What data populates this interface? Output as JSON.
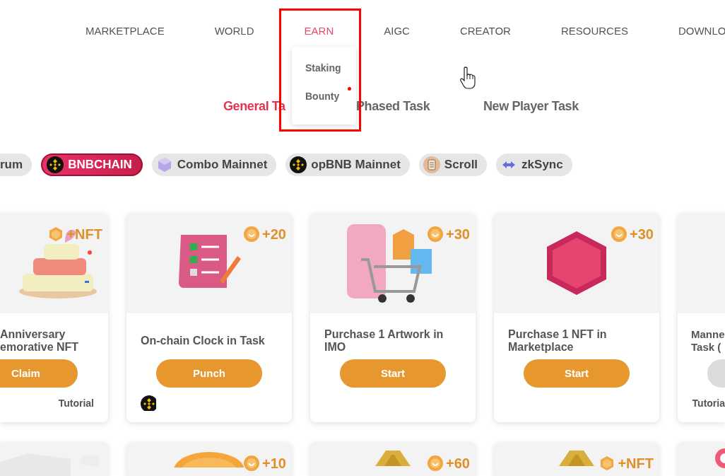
{
  "nav": [
    {
      "label": "MARKETPLACE",
      "selected": false
    },
    {
      "label": "WORLD",
      "selected": false
    },
    {
      "label": "EARN",
      "selected": true
    },
    {
      "label": "AIGC",
      "selected": false
    },
    {
      "label": "CREATOR",
      "selected": false
    },
    {
      "label": "RESOURCES",
      "selected": false
    },
    {
      "label": "DOWNLO",
      "selected": false
    }
  ],
  "earn_menu": {
    "items": [
      {
        "label": "Staking",
        "dot": false
      },
      {
        "label": "Bounty",
        "dot": true
      }
    ]
  },
  "task_tabs": [
    {
      "label": "General Ta",
      "selected": true
    },
    {
      "label": "Phased Task",
      "selected": false
    },
    {
      "label": "New Player Task",
      "selected": false
    }
  ],
  "chains": [
    {
      "label": "rum",
      "selected": false
    },
    {
      "label": "BNBCHAIN",
      "selected": true,
      "kind": "bnb"
    },
    {
      "label": "Combo Mainnet",
      "selected": false,
      "kind": "combo"
    },
    {
      "label": "opBNB Mainnet",
      "selected": false,
      "kind": "bnb"
    },
    {
      "label": "Scroll",
      "selected": false,
      "kind": "scroll"
    },
    {
      "label": "zkSync",
      "selected": false,
      "kind": "zksync"
    }
  ],
  "tasks": [
    {
      "kind": "cake",
      "reward": {
        "kind": "nft",
        "text": "+NFT"
      },
      "title": [
        "Anniversary",
        "emorative NFT"
      ],
      "button": {
        "label": "Claim",
        "disabled": false
      },
      "tutorial": "Tutorial"
    },
    {
      "kind": "checklist",
      "reward": {
        "kind": "coin",
        "text": "+20"
      },
      "title": [
        "On-chain Clock in Task"
      ],
      "button": {
        "label": "Punch",
        "disabled": false
      },
      "chain_badge": true
    },
    {
      "kind": "cart",
      "reward": {
        "kind": "coin",
        "text": "+30"
      },
      "title": [
        "Purchase 1 Artwork in",
        "IMO"
      ],
      "button": {
        "label": "Start",
        "disabled": false
      }
    },
    {
      "kind": "hexagon",
      "reward": {
        "kind": "coin",
        "text": "+30"
      },
      "title": [
        "Purchase 1 NFT in",
        "Marketplace"
      ],
      "button": {
        "label": "Start",
        "disabled": false
      }
    },
    {
      "title": [
        "Manne",
        "Task ("
      ],
      "button": {
        "disabled": true
      },
      "tutorial": "Tutoria"
    }
  ],
  "more_tasks": [
    {
      "kind": "box"
    },
    {
      "kind": "coin",
      "reward": {
        "kind": "coin",
        "text": "+10"
      }
    },
    {
      "kind": "badge",
      "reward": {
        "kind": "coin",
        "text": "+60"
      }
    },
    {
      "kind": "badge",
      "reward": {
        "kind": "nft",
        "text": "+NFT"
      }
    },
    {
      "kind": "ring"
    }
  ]
}
